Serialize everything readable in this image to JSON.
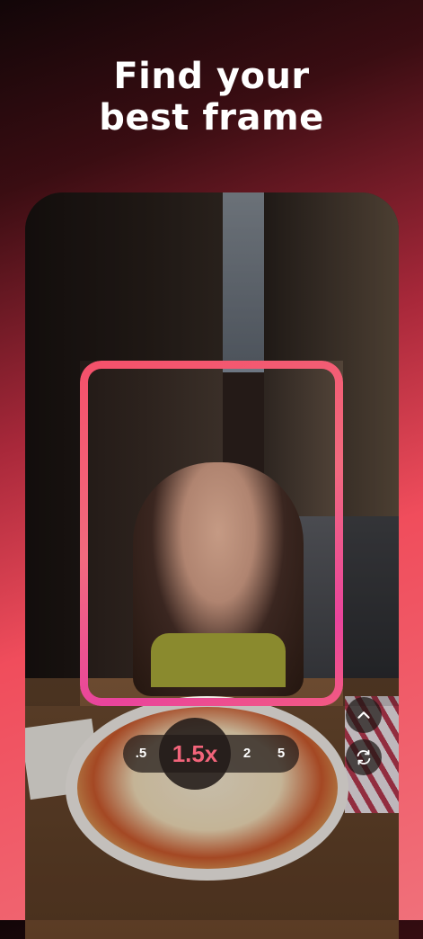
{
  "headline": {
    "line1": "Find your",
    "line2": "best frame"
  },
  "camera": {
    "photo_subject": "woman eating pizza in narrow street",
    "zoom": {
      "options": [
        ".5",
        "1.5x",
        "2",
        "5"
      ],
      "active": "1.5x"
    },
    "controls": {
      "expand_icon": "chevron-up-icon",
      "flip_icon": "flip-camera-icon"
    }
  },
  "colors": {
    "accent": "#f2647a",
    "frame_gradient_start": "#f4506a",
    "frame_gradient_end": "#e9449c"
  }
}
